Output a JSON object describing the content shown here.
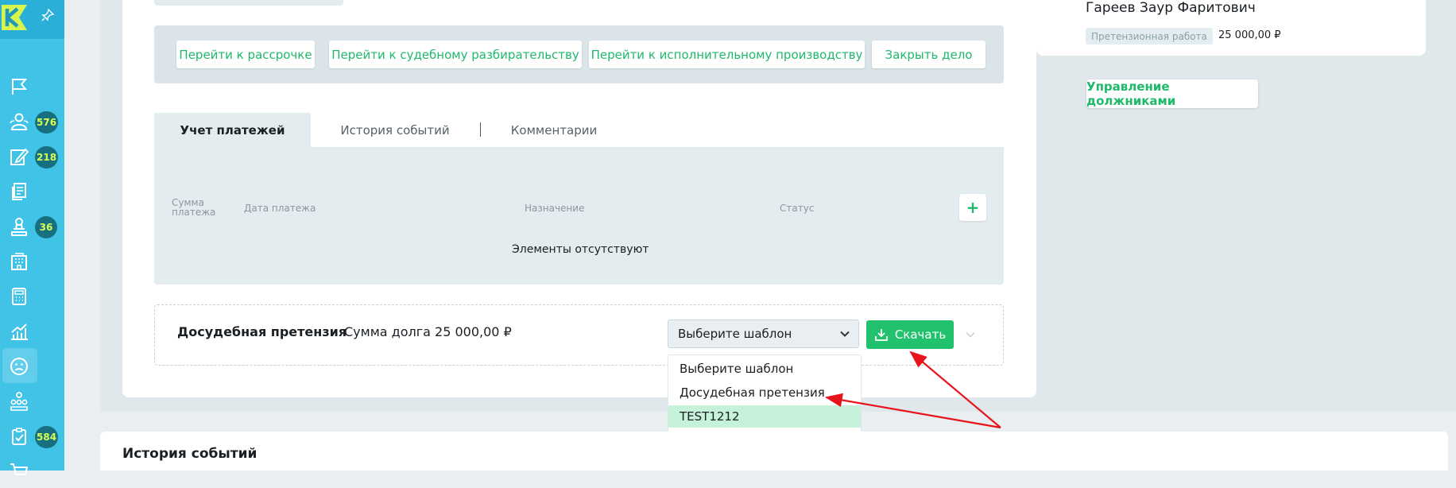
{
  "sidebar": {
    "logo": "K",
    "badges": {
      "clients": "576",
      "tasks": "218",
      "court": "36",
      "checklist": "584"
    }
  },
  "actions": {
    "installment": "Перейти к рассрочке",
    "court": "Перейти к судебному разбирательству",
    "enforcement": "Перейти к исполнительному производству",
    "close_case": "Закрыть дело"
  },
  "tabs": {
    "payments": "Учет платежей",
    "history": "История событий",
    "comments": "Комментарии"
  },
  "payments_table": {
    "col_sum_line1": "Сумма",
    "col_sum_line2": "платежа",
    "col_date": "Дата платежа",
    "col_purpose": "Назначение",
    "col_status": "Статус",
    "add_label": "+",
    "empty_text": "Элементы отсутствуют"
  },
  "claim": {
    "title": "Досудебная претензия",
    "sum": "Сумма долга 25 000,00 ₽",
    "select_value": "Выберите шаблон",
    "download_label": "Скачать",
    "options": [
      "Выберите шаблон",
      "Досудебная претензия",
      "TEST1212"
    ]
  },
  "right_panel": {
    "person_name": "Гареев Заур Фаритович",
    "status": "Претензионная работа",
    "amount": "25 000,00 ₽",
    "manage_label": "Управление должниками"
  },
  "bottom": {
    "title": "История событий"
  },
  "colors": {
    "sidebar": "#41c3e8",
    "accent_green": "#21c16d",
    "badge_bg": "#16707f",
    "badge_text": "#d9ff52",
    "arrow": "#e8141c"
  },
  "icons": [
    "logo-k-icon",
    "pin-icon",
    "flag-icon",
    "people-icon",
    "edit-icon",
    "documents-icon",
    "judge-icon",
    "building-icon",
    "calculator-icon",
    "chart-icon",
    "sad-face-icon",
    "hierarchy-icon",
    "checklist-icon",
    "cart-icon",
    "download-icon",
    "chevron-down-icon"
  ]
}
